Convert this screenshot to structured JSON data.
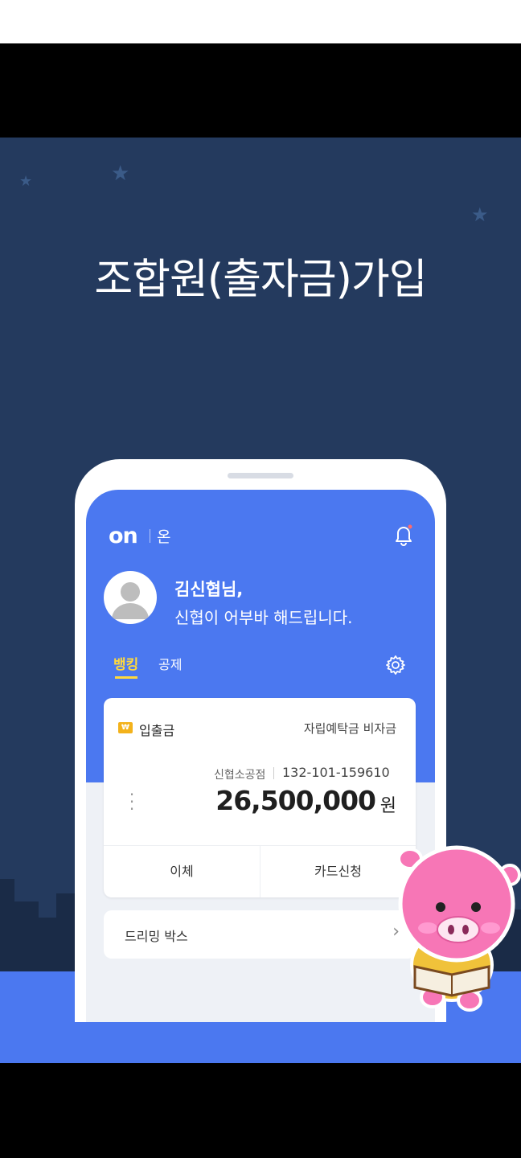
{
  "banner": {
    "headline": "조합원(출자금)가입"
  },
  "app": {
    "logo": "on",
    "logo_sub": "온",
    "greeting_name": "김신협님,",
    "greeting_message": "신협이 어부바 해드립니다.",
    "tabs": [
      {
        "label": "뱅킹",
        "active": true
      },
      {
        "label": "공제",
        "active": false
      }
    ],
    "account": {
      "type": "입출금",
      "badge": "₩",
      "product": "자립예탁금 비자금",
      "branch": "신협소공점",
      "number": "132-101-159610",
      "balance": "26,500,000",
      "currency": "원",
      "actions": [
        "이체",
        "카드신청"
      ]
    },
    "dream_box": {
      "label": "드리밍 박스",
      "chevron": "›"
    }
  },
  "colors": {
    "background": "#243a5e",
    "app_blue": "#4b78f0",
    "tab_active": "#ffd93d",
    "badge": "#f3b21b"
  },
  "icons": [
    "star-icon",
    "bell-icon",
    "avatar-icon",
    "gear-icon",
    "won-icon",
    "more-vert-icon",
    "chevron-right-icon",
    "pig-mascot"
  ]
}
